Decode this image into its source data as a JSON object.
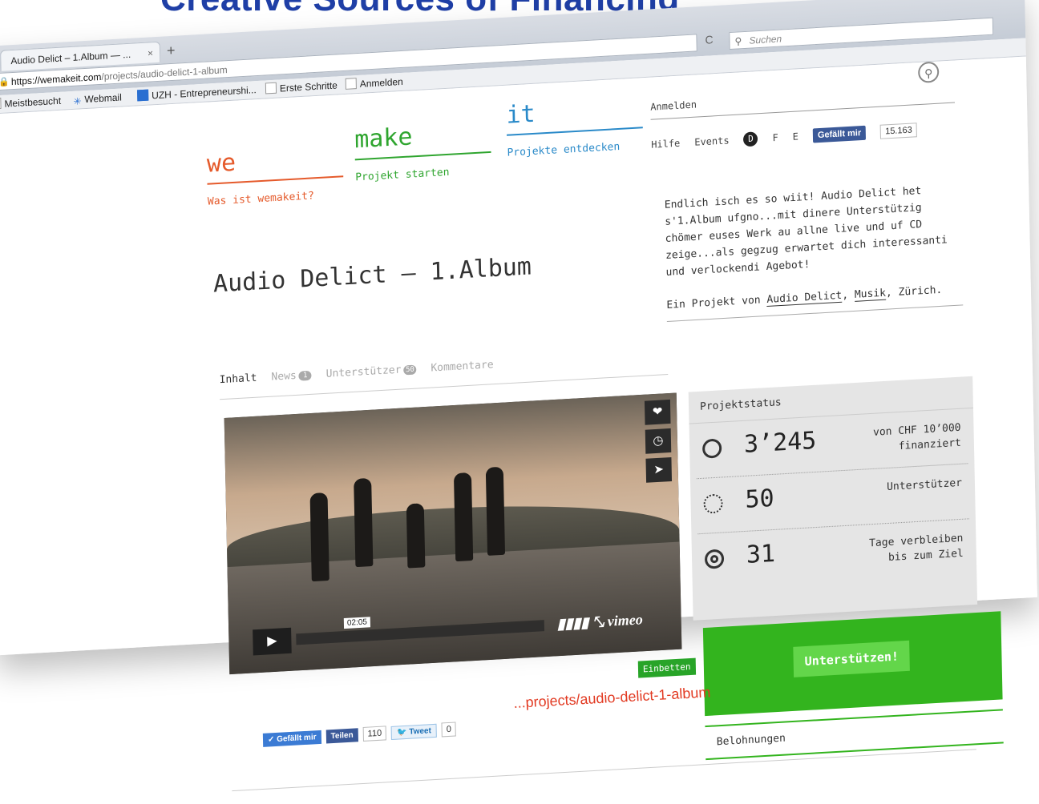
{
  "slide": {
    "title": "Creative Sources of Financing"
  },
  "browser": {
    "tab_title": "Audio Delict – 1.Album — ...",
    "tab_close": "×",
    "new_tab": "+",
    "url_host": "https://wemakeit.com",
    "url_path": "/projects/audio-delict-1-album",
    "reload_icon": "C",
    "search_placeholder": "Suchen",
    "bookmarks": [
      "Meistbesucht",
      "Webmail",
      "UZH - Entrepreneurshi...",
      "Erste Schritte",
      "Anmelden"
    ]
  },
  "site": {
    "logo": [
      {
        "word": "we",
        "link": "Was ist wemakeit?",
        "color": "#e55a2b"
      },
      {
        "word": "make",
        "link": "Projekt starten",
        "color": "#2fa52f"
      },
      {
        "word": "it",
        "link": "Projekte entdecken",
        "color": "#2a8ac9"
      }
    ],
    "anmelden": "Anmelden",
    "hilfe": "Hilfe",
    "events": "Events",
    "lang_d": "D",
    "lang_f": "F",
    "lang_e": "E",
    "fb_like": "Gefällt mir",
    "fb_count": "15.163"
  },
  "project": {
    "title": "Audio Delict – 1.Album",
    "description": "Endlich isch es so wiit! Audio Delict het s'1.Album ufgno...mit dinere Unterstützig chömer euses Werk au allne live und uf CD zeige...als gegzug erwartet dich interessanti und verlockendi Agebot!",
    "byline_prefix": "Ein Projekt von ",
    "byline_author": "Audio Delict",
    "byline_sep": ", ",
    "byline_category": "Musik",
    "byline_city": ", Zürich.",
    "tabs": [
      {
        "label": "Inhalt",
        "badge": ""
      },
      {
        "label": "News",
        "badge": "1"
      },
      {
        "label": "Unterstützer",
        "badge": "50"
      },
      {
        "label": "Kommentare",
        "badge": ""
      }
    ]
  },
  "video": {
    "time": "02:05",
    "brand": "vimeo",
    "embed_label": "Einbetten"
  },
  "social": {
    "like": "Gefällt mir",
    "share": "Teilen",
    "share_count": "110",
    "tweet": "Tweet",
    "tweet_count": "0"
  },
  "status": {
    "heading": "Projektstatus",
    "rows": [
      {
        "value": "3’245",
        "label": "von CHF 10’000 finanziert"
      },
      {
        "value": "50",
        "label": "Unterstützer"
      },
      {
        "value": "31",
        "label": "Tage verbleiben bis zum Ziel"
      }
    ],
    "support_button": "Unterstützen!",
    "rewards": "Belohnungen"
  },
  "caption_url": "...projects/audio-delict-1-album"
}
